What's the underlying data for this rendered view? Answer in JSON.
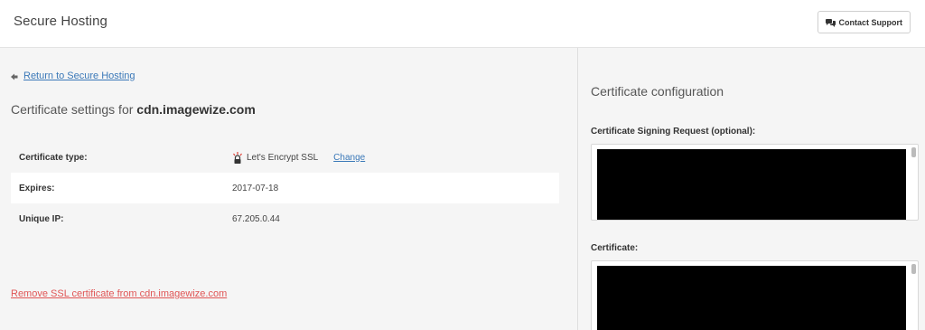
{
  "header": {
    "title": "Secure Hosting",
    "support_button": "Contact Support"
  },
  "left": {
    "back_link": "Return to Secure Hosting",
    "heading_prefix": "Certificate settings for",
    "domain": "cdn.imagewize.com",
    "rows": [
      {
        "label": "Certificate type:",
        "value": "Let's Encrypt SSL",
        "action": "Change"
      },
      {
        "label": "Expires:",
        "value": "2017-07-18"
      },
      {
        "label": "Unique IP:",
        "value": "67.205.0.44"
      }
    ],
    "remove_link": "Remove SSL certificate from cdn.imagewize.com"
  },
  "right": {
    "title": "Certificate configuration",
    "csr_label": "Certificate Signing Request (optional):",
    "cert_label": "Certificate:"
  },
  "colors": {
    "link": "#3a78b8",
    "danger": "#e05555",
    "ssl_icon": "#e0433a"
  },
  "icons": {
    "support": "chat-bubbles-icon",
    "back": "arrow-left-icon",
    "ssl": "lets-encrypt-icon"
  }
}
